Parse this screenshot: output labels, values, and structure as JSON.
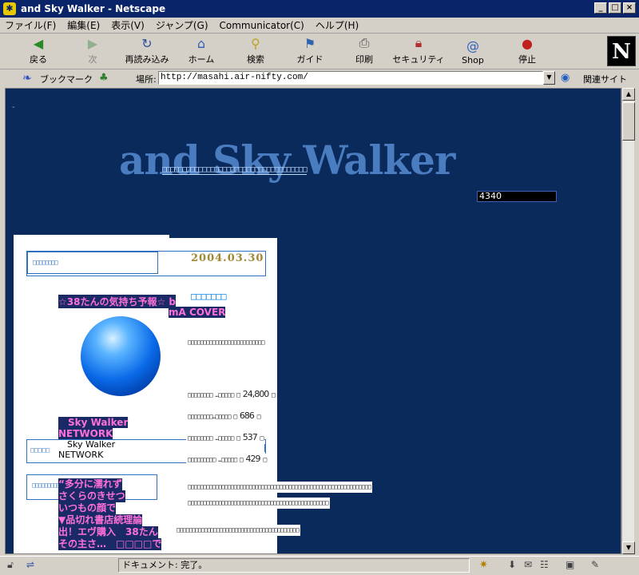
{
  "window": {
    "title": "and Sky Walker - Netscape",
    "minimize": "_",
    "maximize": "□",
    "close": "×"
  },
  "menu": [
    "ファイル(F)",
    "編集(E)",
    "表示(V)",
    "ジャンプ(G)",
    "Communicator(C)",
    "ヘルプ(H)"
  ],
  "toolbar": {
    "back": "戻る",
    "forward": "次",
    "reload": "再読み込み",
    "home": "ホーム",
    "search": "検索",
    "guide": "ガイド",
    "print": "印刷",
    "security": "セキュリティ",
    "shop": "Shop",
    "stop": "停止",
    "logo": "N"
  },
  "location": {
    "bookmarks": "ブックマーク",
    "label": "場所:",
    "url": "http://masahi.air-nifty.com/",
    "related": "関連サイト"
  },
  "page": {
    "site_title": "and Sky Walker",
    "title_squares": "□□□□□□□□□□□□□□□□□□□□□□□□□□□□□□□□□□□□",
    "counter": "4340",
    "header_squares": "□□□□□□□□",
    "date": "2004.03.30",
    "ad_label_1": "☆38たんの気持ち予報☆ b",
    "ad_label_2": "mA COVER",
    "blue_squares": "□□□□□□□",
    "desc_squares": "□□□□□□□□□□□□□□□□□□□□□□□□□",
    "stat_rows": [
      {
        "label": "□□□□□□□□ …□□□□□ □",
        "value": "24,800",
        "end": "□"
      },
      {
        "label": "□□□□□□□□…□□□□□ □",
        "value": "686",
        "end": "□"
      },
      {
        "label": "□□□□□□□□ …□□□□□ □",
        "value": "537",
        "end": "□"
      },
      {
        "label": "□□□□□□□□□ …□□□□□ □",
        "value": "429",
        "end": "□"
      }
    ],
    "network_pink_1": "　Sky Walker",
    "network_pink_2": "NETWORK",
    "network_box_squares": "□□□□□",
    "network_black_1": "　Sky Walker",
    "network_black_2": "NETWORK",
    "long_row_1": "□□□□□□□□□□□□□□□□□□□□□□□□□□□□□□□□□□□□□□□□□□□□□□□□□□□□□□□□□□□□",
    "long_row_2": "□□□□□□□□□□□□□□□□□□□□□□□□□□□□□□□□□□□□□□□□□□□□□□",
    "long_row_3": "□□□□□□□□□□□□□□□□□□□□□□□□□□□□□□□□□□□□□□□□",
    "news_box_squares": "□□□□□□□□□",
    "news_lines": [
      "“多分に濡れず",
      "さくらのきせつ",
      "いつもの顔で",
      "▼品切れ書店続理論",
      "出！エヴ購入　38たん",
      "その主さ…　□□□□で"
    ]
  },
  "status": {
    "text": "ドキュメント: 完了。"
  }
}
